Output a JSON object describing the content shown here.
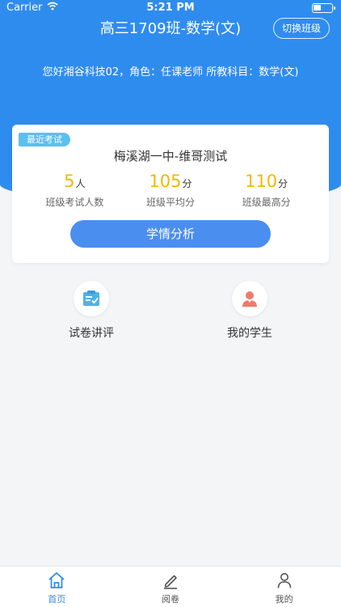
{
  "status_bar": {
    "carrier": "Carrier",
    "time": "5:21 PM"
  },
  "header": {
    "class_title": "高三1709班-数学(文)",
    "switch_label": "切换班级",
    "user_info": "您好湘谷科技02，角色：任课老师 所教科目：数学(文)"
  },
  "exam_card": {
    "badge": "最近考试",
    "exam_name": "梅溪湖一中-维哥测试",
    "stats": [
      {
        "value": "5",
        "unit": "人",
        "label": "班级考试人数"
      },
      {
        "value": "105",
        "unit": "分",
        "label": "班级平均分"
      },
      {
        "value": "110",
        "unit": "分",
        "label": "班级最高分"
      }
    ],
    "analysis_button": "学情分析"
  },
  "features": [
    {
      "label": "试卷讲评",
      "icon": "paper-review-icon"
    },
    {
      "label": "我的学生",
      "icon": "student-icon"
    }
  ],
  "tabbar": {
    "items": [
      {
        "label": "首页",
        "icon": "home-icon",
        "active": true
      },
      {
        "label": "阅卷",
        "icon": "pen-icon",
        "active": false
      },
      {
        "label": "我的",
        "icon": "person-icon",
        "active": false
      }
    ]
  },
  "colors": {
    "brand_blue": "#2f8cef",
    "button_blue": "#4a8ef0",
    "badge_blue": "#5bc0ef",
    "stat_yellow": "#f5b800",
    "student_icon_red": "#f07a6a"
  }
}
